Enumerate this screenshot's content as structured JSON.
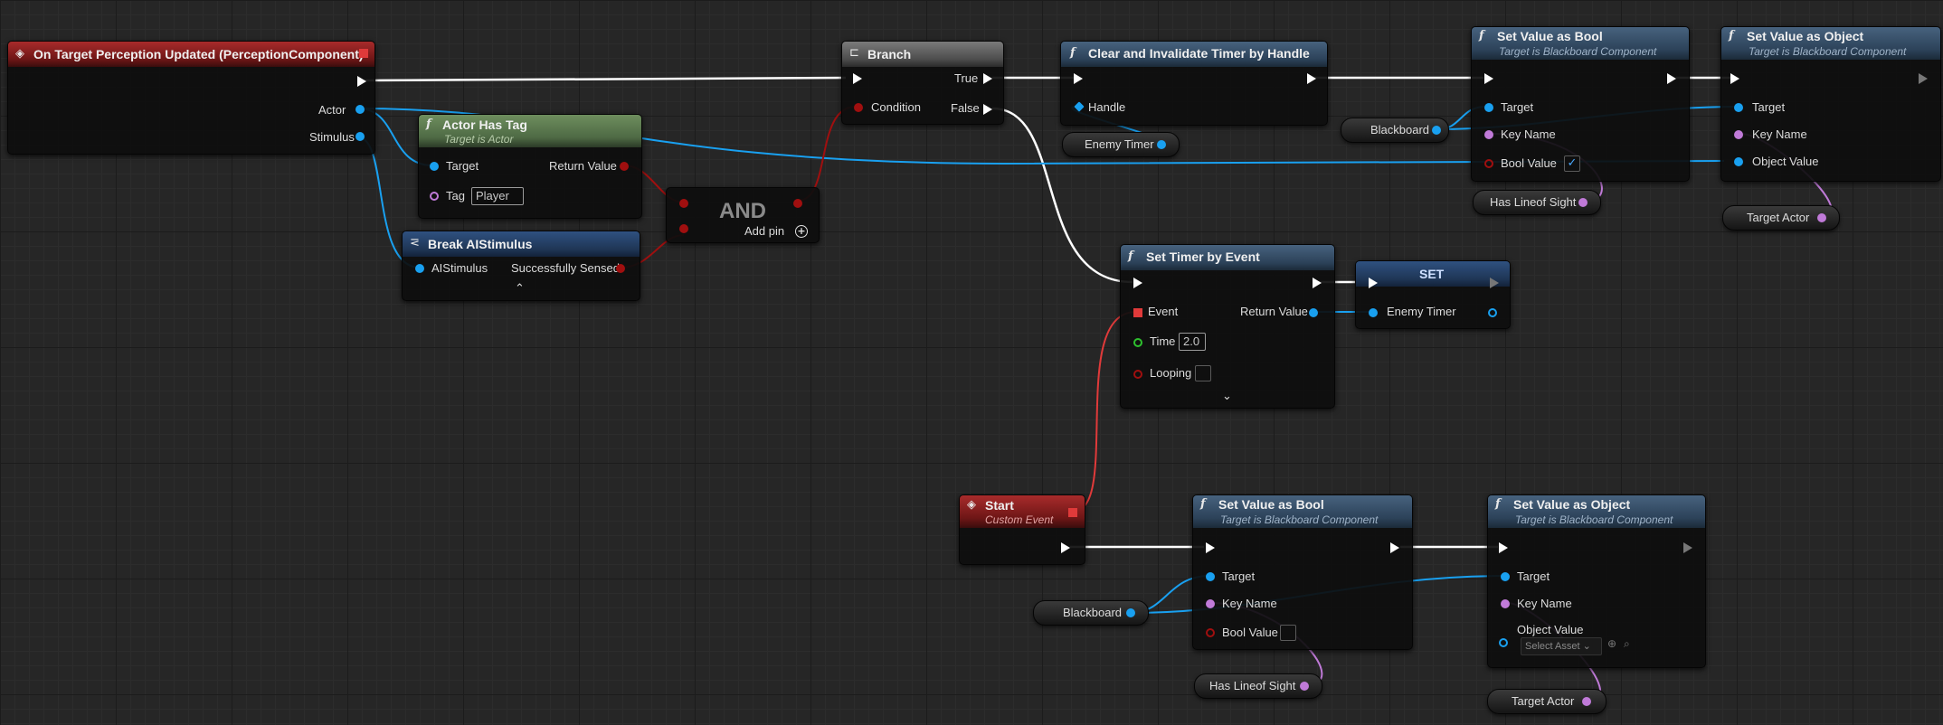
{
  "colors": {
    "exec_wire": "#ffffff",
    "object_wire": "#19a0f0",
    "name_wire": "#c07ad8",
    "bool_wire": "#a00f0f",
    "delegate_wire": "#e03a3a"
  },
  "icons": {
    "event": "diamond-arrow-icon",
    "function": "function-icon",
    "branch": "branch-icon",
    "break_struct": "break-struct-icon",
    "delegate": "delegate-square-icon"
  },
  "event_node": {
    "title": "On Target Perception Updated (PerceptionComponent)",
    "pins": [
      "Actor",
      "Stimulus"
    ]
  },
  "actor_has_tag": {
    "title": "Actor Has Tag",
    "subtitle": "Target is Actor",
    "target": "Target",
    "return_value": "Return Value",
    "tag_label": "Tag",
    "tag_value": "Player"
  },
  "break_stimulus": {
    "title": "Break AIStimulus",
    "input": "AIStimulus",
    "output": "Successfully Sensed"
  },
  "and_node": {
    "title": "AND",
    "add_pin": "Add pin"
  },
  "branch": {
    "title": "Branch",
    "condition": "Condition",
    "true_label": "True",
    "false_label": "False"
  },
  "clear_timer": {
    "title": "Clear and Invalidate Timer by Handle",
    "handle": "Handle"
  },
  "enemy_timer_var": "Enemy Timer",
  "set_bool_top": {
    "title": "Set Value as Bool",
    "subtitle": "Target is Blackboard Component",
    "target": "Target",
    "key_name": "Key Name",
    "bool_value": "Bool Value",
    "checked": true
  },
  "set_object_top": {
    "title": "Set Value as Object",
    "subtitle": "Target is Blackboard Component",
    "target": "Target",
    "key_name": "Key Name",
    "object_value": "Object Value"
  },
  "blackboard_var": "Blackboard",
  "has_lineof_sight_var": "Has Lineof Sight",
  "target_actor_var": "Target Actor",
  "set_timer": {
    "title": "Set Timer by Event",
    "event": "Event",
    "return_value": "Return Value",
    "time_label": "Time",
    "time_value": "2.0",
    "looping": "Looping"
  },
  "set_node": {
    "title": "SET",
    "pin": "Enemy Timer"
  },
  "start_event": {
    "title": "Start",
    "subtitle": "Custom Event"
  },
  "set_bool_bottom": {
    "title": "Set Value as Bool",
    "subtitle": "Target is Blackboard Component",
    "target": "Target",
    "key_name": "Key Name",
    "bool_value": "Bool Value",
    "checked": false
  },
  "set_object_bottom": {
    "title": "Set Value as Object",
    "subtitle": "Target is Blackboard Component",
    "target": "Target",
    "key_name": "Key Name",
    "object_value": "Object Value",
    "select_asset": "Select Asset"
  }
}
